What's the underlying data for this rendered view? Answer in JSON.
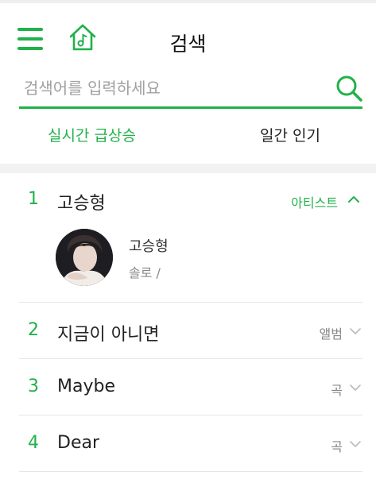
{
  "header": {
    "title": "검색"
  },
  "search": {
    "placeholder": "검색어를 입력하세요"
  },
  "tabs": [
    {
      "label": "실시간 급상승",
      "active": true
    },
    {
      "label": "일간 인기",
      "active": false
    }
  ],
  "results": [
    {
      "rank": "1",
      "title": "고승형",
      "type": "아티스트",
      "expanded": true
    },
    {
      "rank": "2",
      "title": "지금이 아니면",
      "type": "앨범",
      "expanded": false
    },
    {
      "rank": "3",
      "title": "Maybe",
      "type": "곡",
      "expanded": false
    },
    {
      "rank": "4",
      "title": "Dear",
      "type": "곡",
      "expanded": false
    }
  ],
  "artist_card": {
    "name": "고승형",
    "meta": "솔로 /"
  },
  "colors": {
    "accent": "#21b14a",
    "text": "#222222",
    "muted": "#888888",
    "divider": "#e6e6e6"
  },
  "icons": [
    "menu-icon",
    "home-music-icon",
    "search-icon",
    "chevron-up-icon",
    "chevron-down-icon"
  ]
}
